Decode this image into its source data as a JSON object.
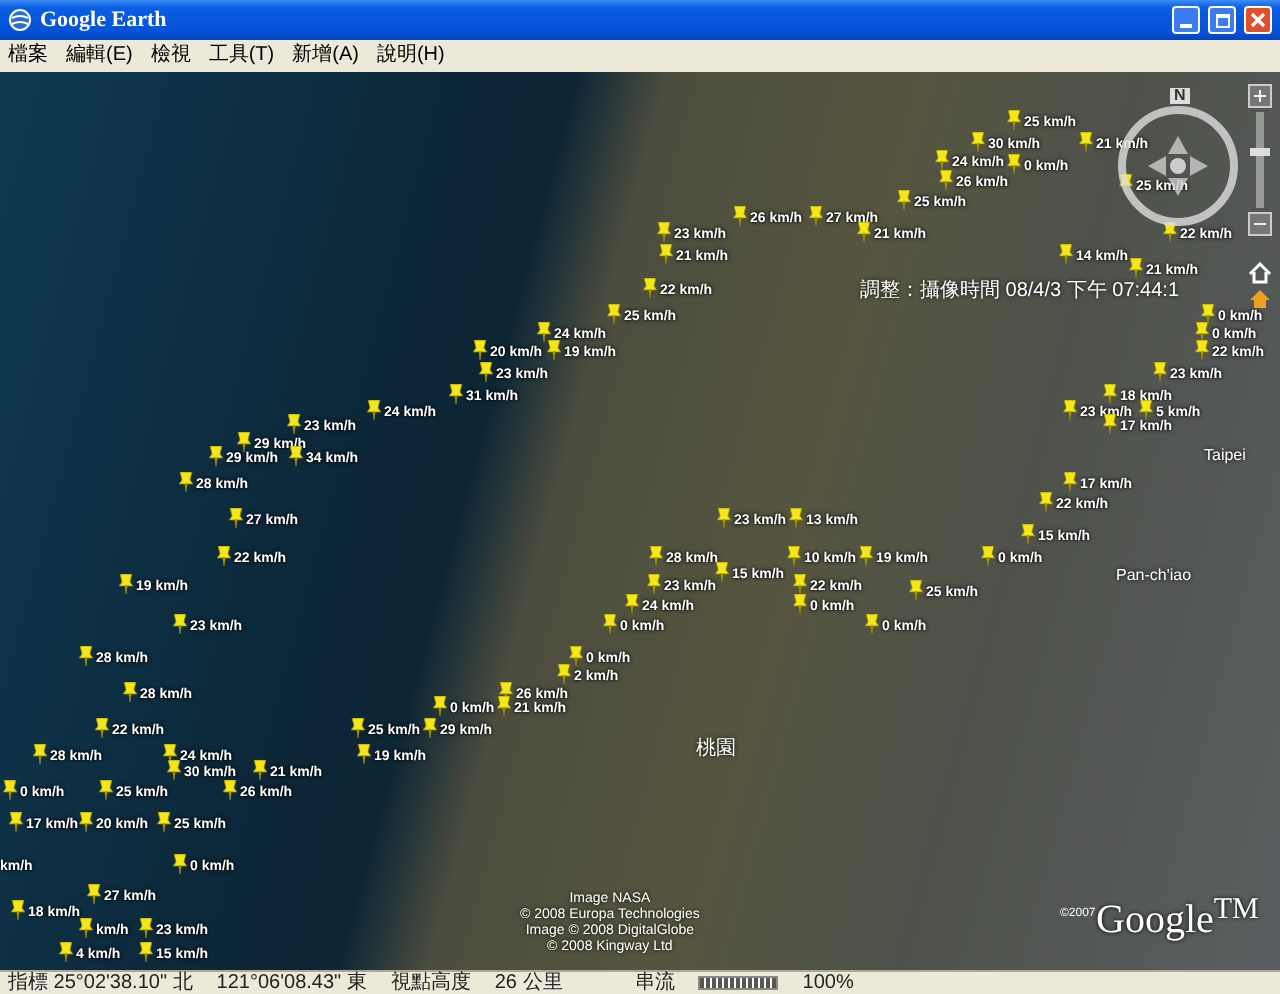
{
  "window": {
    "title": "Google Earth"
  },
  "menu": [
    "檔案",
    "編輯(E)",
    "檢視",
    "工具(T)",
    "新增(A)",
    "說明(H)"
  ],
  "map": {
    "placemarks": [
      {
        "label": "25 km/h"
      },
      {
        "label": "30 km/h"
      },
      {
        "label": "21 km/h"
      },
      {
        "label": "24 km/h"
      },
      {
        "label": "0 km/h"
      },
      {
        "label": "26 km/h"
      },
      {
        "label": "25 km/h"
      },
      {
        "label": "25 km/h"
      },
      {
        "label": "26 km/h"
      },
      {
        "label": "27 km/h"
      },
      {
        "label": "23 km/h"
      },
      {
        "label": "21 km/h"
      },
      {
        "label": "22 km/h"
      },
      {
        "label": "21 km/h"
      },
      {
        "label": "14 km/h"
      },
      {
        "label": "21 km/h"
      },
      {
        "label": "22 km/h"
      },
      {
        "label": "25 km/h"
      },
      {
        "label": "0 km/h"
      },
      {
        "label": "24 km/h"
      },
      {
        "label": "0 km/h"
      },
      {
        "label": "20 km/h"
      },
      {
        "label": "19 km/h"
      },
      {
        "label": "22 km/h"
      },
      {
        "label": "23 km/h"
      },
      {
        "label": "23 km/h"
      },
      {
        "label": "31 km/h"
      },
      {
        "label": "18 km/h"
      },
      {
        "label": "24 km/h"
      },
      {
        "label": "23 km/h"
      },
      {
        "label": "5 km/h"
      },
      {
        "label": "23 km/h"
      },
      {
        "label": "17 km/h"
      },
      {
        "label": "29 km/h"
      },
      {
        "label": "29 km/h"
      },
      {
        "label": "34 km/h"
      },
      {
        "label": "28 km/h"
      },
      {
        "label": "17 km/h"
      },
      {
        "label": "22 km/h"
      },
      {
        "label": "27 km/h"
      },
      {
        "label": "23 km/h"
      },
      {
        "label": "13 km/h"
      },
      {
        "label": "15 km/h"
      },
      {
        "label": "22 km/h"
      },
      {
        "label": "28 km/h"
      },
      {
        "label": "10 km/h"
      },
      {
        "label": "19 km/h"
      },
      {
        "label": "0 km/h"
      },
      {
        "label": "15 km/h"
      },
      {
        "label": "19 km/h"
      },
      {
        "label": "23 km/h"
      },
      {
        "label": "22 km/h"
      },
      {
        "label": "25 km/h"
      },
      {
        "label": "24 km/h"
      },
      {
        "label": "0 km/h"
      },
      {
        "label": "23 km/h"
      },
      {
        "label": "0 km/h"
      },
      {
        "label": "0 km/h"
      },
      {
        "label": "28 km/h"
      },
      {
        "label": "0 km/h"
      },
      {
        "label": "2 km/h"
      },
      {
        "label": "28 km/h"
      },
      {
        "label": "26 km/h"
      },
      {
        "label": "0 km/h"
      },
      {
        "label": "21 km/h"
      },
      {
        "label": "22 km/h"
      },
      {
        "label": "25 km/h"
      },
      {
        "label": "29 km/h"
      },
      {
        "label": "28 km/h"
      },
      {
        "label": "24 km/h"
      },
      {
        "label": "19 km/h"
      },
      {
        "label": "30 km/h"
      },
      {
        "label": "21 km/h"
      },
      {
        "label": "0 km/h"
      },
      {
        "label": "25 km/h"
      },
      {
        "label": "26 km/h"
      },
      {
        "label": "17 km/h"
      },
      {
        "label": "20 km/h"
      },
      {
        "label": "25 km/h"
      },
      {
        "label": "km/h"
      },
      {
        "label": "0 km/h"
      },
      {
        "label": "27 km/h"
      },
      {
        "label": "18 km/h"
      },
      {
        "label": "km/h"
      },
      {
        "label": "23 km/h"
      },
      {
        "label": "4 km/h"
      },
      {
        "label": "15 km/h"
      }
    ],
    "place_labels": [
      "Taipei",
      "Pan-ch'iao",
      "桃園"
    ],
    "info_label": "調整：攝像時間 08/4/3 下午 07:44:1",
    "navigation": {
      "north": "N",
      "zoom": {
        "level": 0.6
      }
    },
    "attribution": [
      "Image NASA",
      "© 2008 Europa Technologies",
      "Image © 2008 DigitalGlobe",
      "© 2008 Kingway Ltd"
    ],
    "logo": {
      "copyright": "©2007",
      "name": "Google",
      "mark": "TM"
    }
  },
  "status_bar": {
    "pointer": "指標 25°02'38.10\" 北",
    "longitude": "121°06'08.43\" 東",
    "altitude_label": "視點高度",
    "altitude": "26 公里",
    "streaming": {
      "label": "串流",
      "level": 1,
      "percent": "100%"
    }
  }
}
